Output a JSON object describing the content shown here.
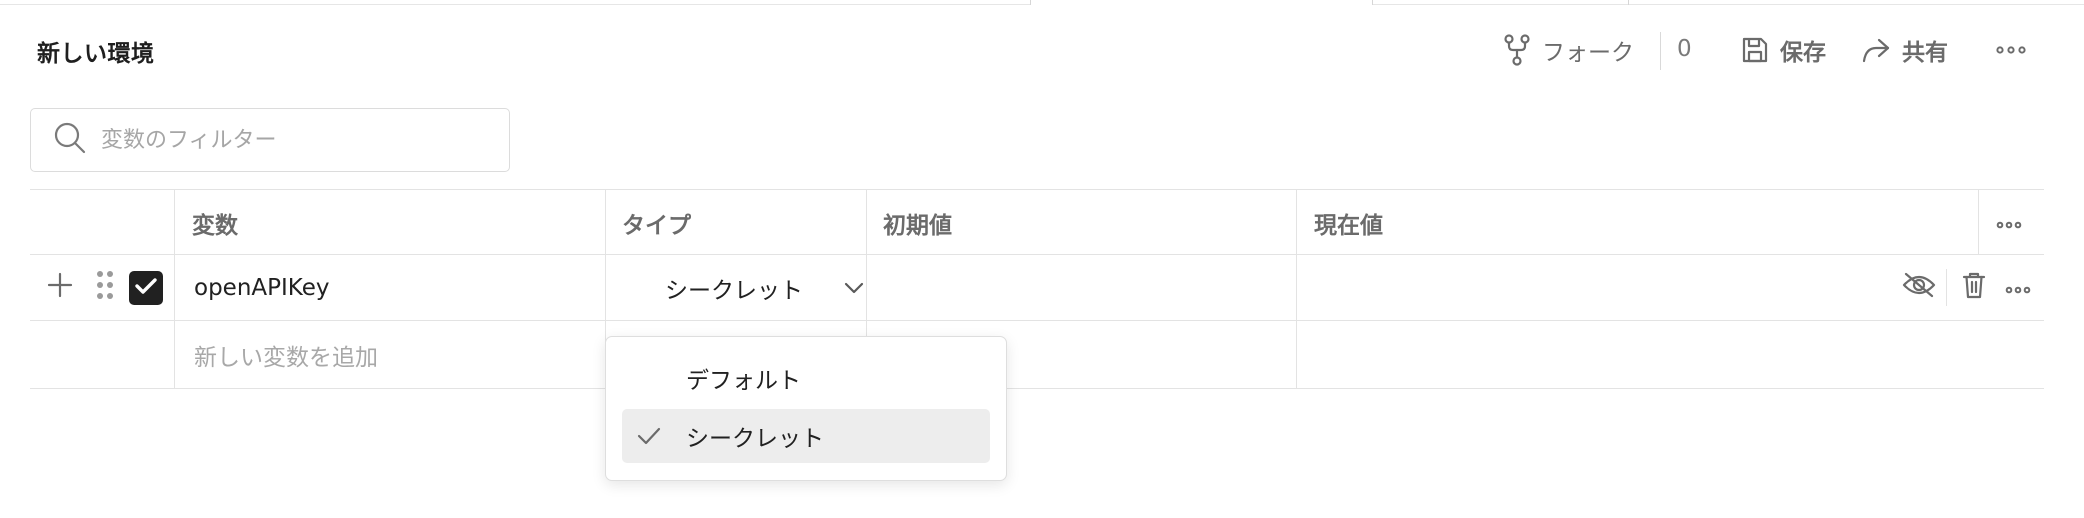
{
  "header": {
    "title": "新しい環境",
    "fork_label": "フォーク",
    "fork_count": "0",
    "save_label": "保存",
    "share_label": "共有"
  },
  "search": {
    "placeholder": "変数のフィルター"
  },
  "table": {
    "columns": [
      "変数",
      "タイプ",
      "初期値",
      "現在値"
    ],
    "rows": [
      {
        "variable": "openAPIKey",
        "type": "シークレット",
        "initial_value": "",
        "current_value": "",
        "enabled": true
      }
    ],
    "add_placeholder": "新しい変数を追加"
  },
  "type_dropdown": {
    "options": [
      "デフォルト",
      "シークレット"
    ],
    "selected": "シークレット"
  },
  "icons": {
    "fork": "fork-icon",
    "save": "floppy-disk-icon",
    "share": "share-arrow-icon",
    "more": "more-horizontal-icon",
    "search": "search-icon",
    "add": "plus-icon",
    "drag": "drag-handle-icon",
    "checkbox": "checkbox-checked-icon",
    "chevron": "chevron-down-icon",
    "eye_off": "eye-off-icon",
    "delete": "trash-icon",
    "check": "check-icon"
  },
  "colors": {
    "checkbox_fill": "#212121",
    "selected_option_bg": "#ededed",
    "muted_text": "#6b6b6b"
  }
}
